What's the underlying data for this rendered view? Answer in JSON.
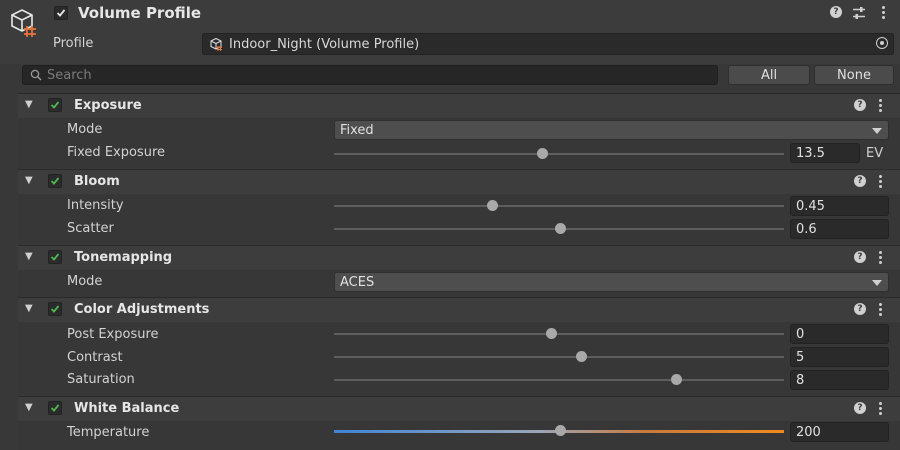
{
  "header": {
    "title": "Volume Profile",
    "enabled": true,
    "profile_label": "Profile",
    "profile_value": "Indoor_Night (Volume Profile)"
  },
  "search": {
    "placeholder": "Search"
  },
  "buttons": {
    "all": "All",
    "none": "None"
  },
  "sections": {
    "exposure": {
      "title": "Exposure",
      "mode_label": "Mode",
      "mode_value": "Fixed",
      "fixed_label": "Fixed Exposure",
      "fixed_value": "13.5",
      "fixed_unit": "EV"
    },
    "bloom": {
      "title": "Bloom",
      "intensity_label": "Intensity",
      "intensity_value": "0.45",
      "scatter_label": "Scatter",
      "scatter_value": "0.6"
    },
    "tonemapping": {
      "title": "Tonemapping",
      "mode_label": "Mode",
      "mode_value": "ACES"
    },
    "color_adjustments": {
      "title": "Color Adjustments",
      "post_label": "Post Exposure",
      "post_value": "0",
      "contrast_label": "Contrast",
      "contrast_value": "5",
      "saturation_label": "Saturation",
      "saturation_value": "8"
    },
    "white_balance": {
      "title": "White Balance",
      "temperature_label": "Temperature",
      "temperature_value": "200"
    }
  },
  "colors": {
    "accent_check": "#4fb84f",
    "temperature_cold": "#3f84d6",
    "temperature_warm": "#f08a1e"
  }
}
